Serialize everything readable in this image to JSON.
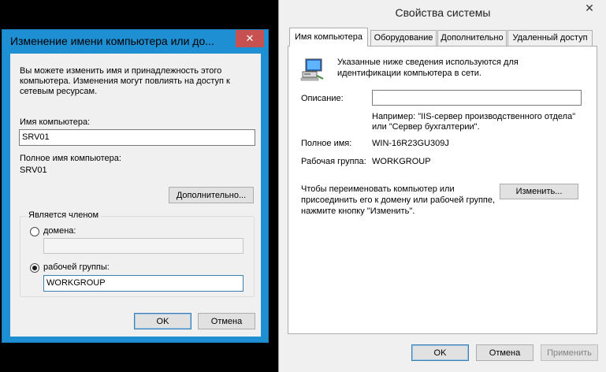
{
  "system_properties": {
    "title": "Свойства системы",
    "close_glyph": "✕",
    "tabs": [
      {
        "label": "Имя компьютера"
      },
      {
        "label": "Оборудование"
      },
      {
        "label": "Дополнительно"
      },
      {
        "label": "Удаленный доступ"
      }
    ],
    "intro_line1": "Указанные ниже сведения используются для",
    "intro_line2": "идентификации компьютера в сети.",
    "description_label": "Описание:",
    "description_value": "",
    "example_line1": "Например: \"IIS-сервер производственного отдела\"",
    "example_line2": "или \"Сервер бухгалтерии\".",
    "full_name_label": "Полное имя:",
    "full_name_value": "WIN-16R23GU309J",
    "workgroup_label": "Рабочая группа:",
    "workgroup_value": "WORKGROUP",
    "rename_line1": "Чтобы переименовать компьютер или",
    "rename_line2": "присоединить его к домену или рабочей группе,",
    "rename_line3": "нажмите кнопку \"Изменить\".",
    "change_button": "Изменить...",
    "ok_button": "OK",
    "cancel_button": "Отмена",
    "apply_button": "Применить",
    "icon": "computer-network-icon"
  },
  "rename_dialog": {
    "title": "Изменение имени компьютера или до...",
    "close_glyph": "✕",
    "intro_line1": "Вы можете изменить имя и принадлежность этого",
    "intro_line2": "компьютера. Изменения могут повлиять на доступ к",
    "intro_line3": "сетевым ресурсам.",
    "computer_name_label": "Имя компьютера:",
    "computer_name_value": "SRV01",
    "full_name_label": "Полное имя компьютера:",
    "full_name_value": "SRV01",
    "more_button": "Дополнительно...",
    "member_of_label": "Является членом",
    "domain_label": "домена:",
    "domain_value": "",
    "workgroup_label": "рабочей группы:",
    "workgroup_value": "WORKGROUP",
    "selected_membership": "workgroup",
    "ok_button": "OK",
    "cancel_button": "Отмена"
  },
  "colors": {
    "dialog_frame": "#1e8fd2",
    "close_button": "#c75050",
    "window_background": "#f0f0f0",
    "desktop": "#000000"
  }
}
